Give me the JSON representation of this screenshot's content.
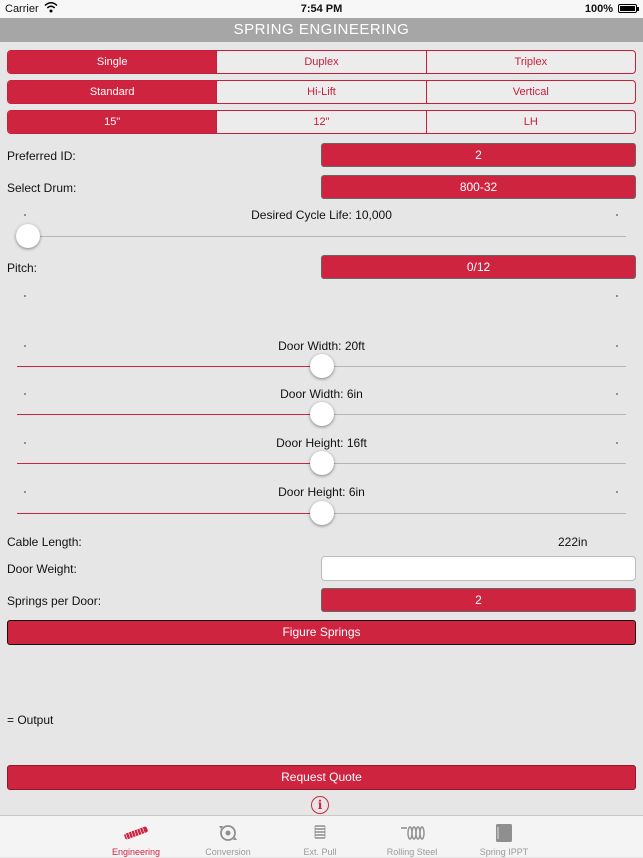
{
  "status": {
    "carrier": "Carrier",
    "time": "7:54 PM",
    "battery": "100%"
  },
  "title": "SPRING ENGINEERING",
  "seg_springs": [
    "Single",
    "Duplex",
    "Triplex"
  ],
  "seg_lift": [
    "Standard",
    "Hi-Lift",
    "Vertical"
  ],
  "seg_radius": [
    "15\"",
    "12\"",
    "LH"
  ],
  "preferred_id": {
    "label": "Preferred ID:",
    "value": "2"
  },
  "select_drum": {
    "label": "Select Drum:",
    "value": "800-32"
  },
  "cycle_life": {
    "label": "Desired Cycle Life: 10,000",
    "level": 0
  },
  "pitch": {
    "label": "Pitch:",
    "value": "0/12"
  },
  "door_width_ft": {
    "label": "Door Width: 20ft",
    "level": 0.5
  },
  "door_width_in": {
    "label": "Door Width: 6in",
    "level": 0.5
  },
  "door_height_ft": {
    "label": "Door Height: 16ft",
    "level": 0.5
  },
  "door_height_in": {
    "label": "Door Height: 6in",
    "level": 0.5
  },
  "cable_length": {
    "label": "Cable Length:",
    "value": "222in"
  },
  "door_weight": {
    "label": "Door Weight:",
    "value": ""
  },
  "springs_per_door": {
    "label": "Springs per Door:",
    "value": "2"
  },
  "figure_button": "Figure Springs",
  "output_label": "= Output",
  "quote_button": "Request Quote",
  "info_glyph": "i",
  "tabs": [
    "Engineering",
    "Conversion",
    "Ext. Pull",
    "Rolling Steel",
    "Spring IPPT"
  ],
  "colors": {
    "accent": "#cf2440",
    "background": "#e6e6e6",
    "title_bar": "#a6a6a6"
  }
}
